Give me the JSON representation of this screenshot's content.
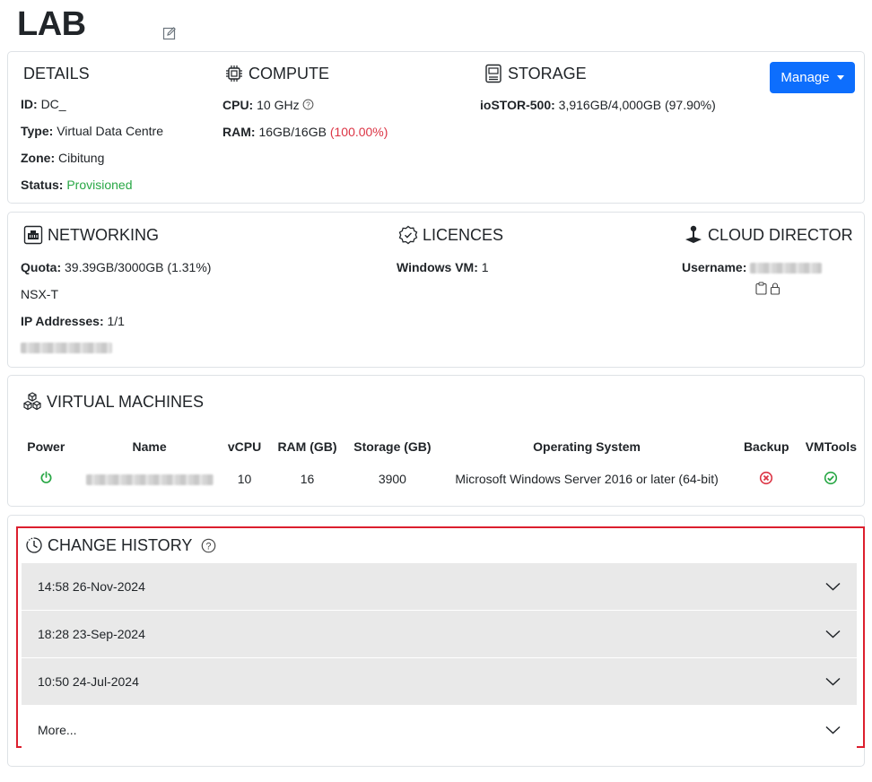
{
  "page": {
    "title": "LAB"
  },
  "details": {
    "heading": "DETAILS",
    "id_label": "ID:",
    "id_value": "DC_",
    "type_label": "Type:",
    "type_value": "Virtual Data Centre",
    "zone_label": "Zone:",
    "zone_value": "Cibitung",
    "status_label": "Status:",
    "status_value": "Provisioned"
  },
  "compute": {
    "heading": "COMPUTE",
    "cpu_label": "CPU:",
    "cpu_value": "10 GHz",
    "ram_label": "RAM:",
    "ram_value": "16GB/16GB",
    "ram_pct": "(100.00%)"
  },
  "storage": {
    "heading": "STORAGE",
    "name_label": "ioSTOR-500:",
    "value": "3,916GB/4,000GB (97.90%)"
  },
  "manage": {
    "label": "Manage"
  },
  "networking": {
    "heading": "NETWORKING",
    "quota_label": "Quota:",
    "quota_value": "39.39GB/3000GB (1.31%)",
    "type": "NSX-T",
    "ip_label": "IP Addresses:",
    "ip_value": "1/1"
  },
  "licences": {
    "heading": "LICENCES",
    "windows_label": "Windows VM:",
    "windows_value": "1"
  },
  "cloud_director": {
    "heading": "CLOUD DIRECTOR",
    "username_label": "Username:"
  },
  "virtual_machines": {
    "heading": "VIRTUAL MACHINES",
    "columns": [
      "Power",
      "Name",
      "vCPU",
      "RAM (GB)",
      "Storage (GB)",
      "Operating System",
      "Backup",
      "VMTools"
    ],
    "rows": [
      {
        "vcpu": "10",
        "ram": "16",
        "storage": "3900",
        "os": "Microsoft Windows Server 2016 or later (64-bit)"
      }
    ]
  },
  "change_history": {
    "heading": "CHANGE HISTORY",
    "items": [
      "14:58 26-Nov-2024",
      "18:28 23-Sep-2024",
      "10:50 24-Jul-2024"
    ],
    "more_label": "More..."
  },
  "colors": {
    "accent": "#0d6efd",
    "success": "#28a745",
    "danger": "#dc3545",
    "highlight_border": "#dc1f2e"
  }
}
